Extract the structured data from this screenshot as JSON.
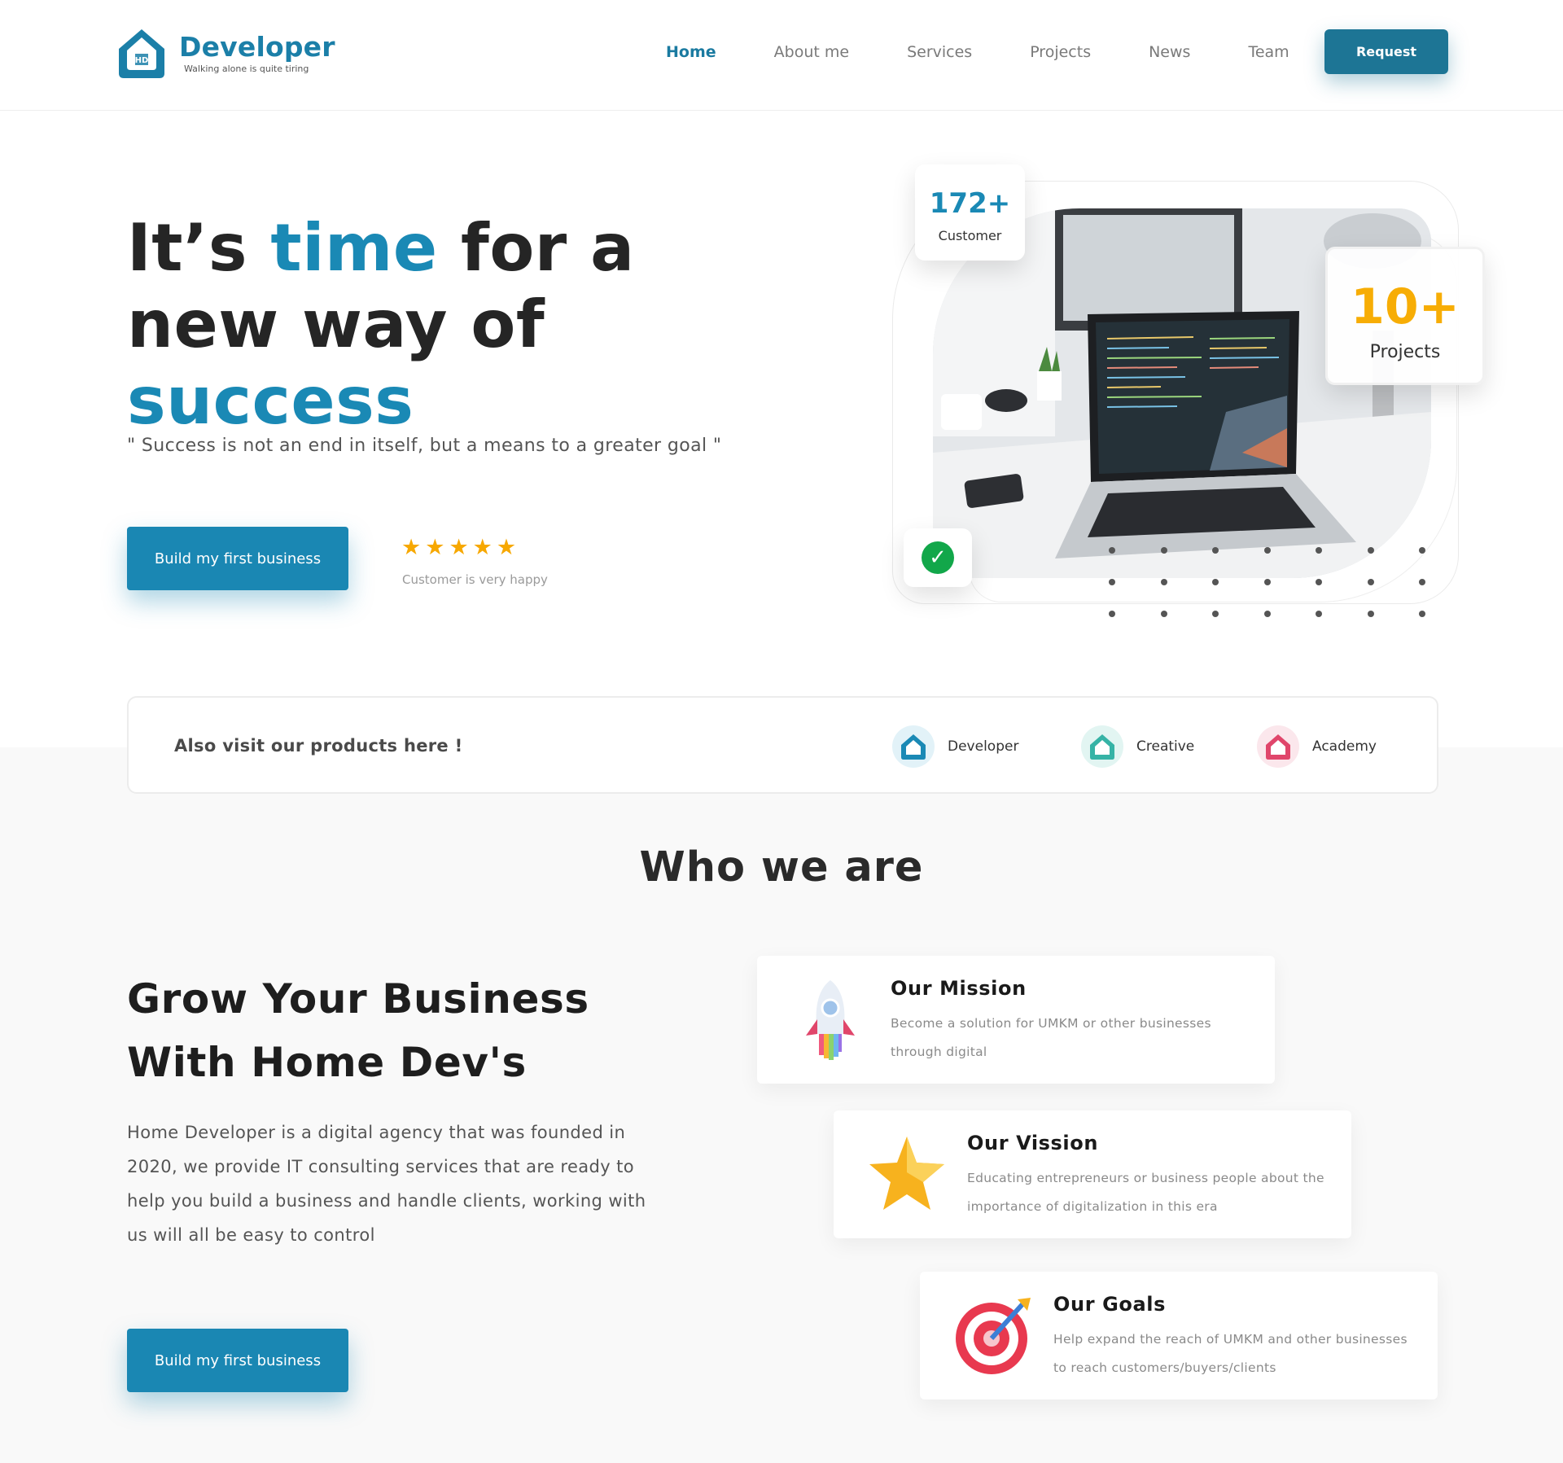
{
  "header": {
    "brand": "Developer",
    "tagline": "Walking alone is quite tiring",
    "logo_mark": "HD",
    "nav": [
      "Home",
      "About me",
      "Services",
      "Projects",
      "News",
      "Team"
    ],
    "active_nav": "Home",
    "request_label": "Request"
  },
  "hero": {
    "title_part1": "It’s ",
    "title_hl1": "time",
    "title_part2": " for a new way of ",
    "title_hl2": "success",
    "quote": "\" Success is not an end in itself, but a means to a greater goal \"",
    "cta_label": "Build my first business",
    "rating_stars": 5,
    "rating_caption": "Customer is very happy",
    "customers_value": "172+",
    "customers_label": "Customer",
    "projects_value": "10+",
    "projects_label": "Projects"
  },
  "products": {
    "title": "Also visit our products here !",
    "items": [
      {
        "label": "Developer",
        "mark": "HD",
        "color": "#1a89b5"
      },
      {
        "label": "Creative",
        "mark": "HC",
        "color": "#36b3a6"
      },
      {
        "label": "Academy",
        "mark": "HA",
        "color": "#e0466b"
      }
    ]
  },
  "who": {
    "section_title": "Who we are",
    "heading_line1": "Grow Your Business",
    "heading_line2": "With Home Dev's",
    "body": "Home Developer is a digital agency that was founded in 2020, we provide IT consulting services that are ready to help you build a business and handle clients, working with us will all be easy to control",
    "cta_label": "Build my first business",
    "cards": [
      {
        "icon": "rocket-icon",
        "title": "Our Mission",
        "text": "Become a solution for UMKM or other businesses through digital"
      },
      {
        "icon": "star-icon",
        "title": "Our Vission",
        "text": "Educating entrepreneurs or business people about the importance of digitalization in this era"
      },
      {
        "icon": "target-icon",
        "title": "Our Goals",
        "text": "Help expand the reach of UMKM and other businesses to reach customers/buyers/clients"
      }
    ]
  },
  "colors": {
    "accent": "#1a89b5",
    "button_dark": "#1d7595",
    "yellow": "#f7ad05",
    "check_green": "#12a74a"
  }
}
